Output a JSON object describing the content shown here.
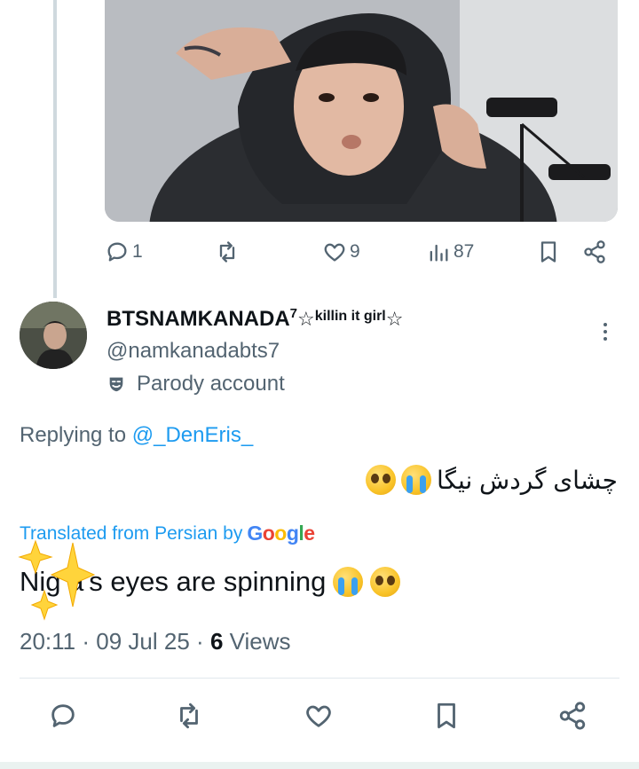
{
  "media": {
    "icon": "photo-of-person-in-black-hoodie"
  },
  "tweet_actions": {
    "reply_count": "1",
    "retweet_count": "",
    "like_count": "9",
    "views_count": "87"
  },
  "reply": {
    "display_name": "BTSNAMKANADA",
    "name_sup": "7",
    "name_star": "☆",
    "name_suffix": "killin it girl",
    "handle": "@namkanadabts7",
    "account_label": "Parody account",
    "replying_prefix": "Replying to ",
    "replying_to": "@_DenEris_",
    "text_persian": "چشای گردش نیگا",
    "translated_label": "Translated from Persian by",
    "translator": "Google",
    "translated_text": "Nig  a's eyes are spinning",
    "time": "20:11",
    "sep": "·",
    "date": "09 Jul 25",
    "views_count": "6",
    "views_label": "Views"
  },
  "colors": {
    "accent": "#1d9bf0",
    "muted": "#536471",
    "text": "#0f1419"
  }
}
